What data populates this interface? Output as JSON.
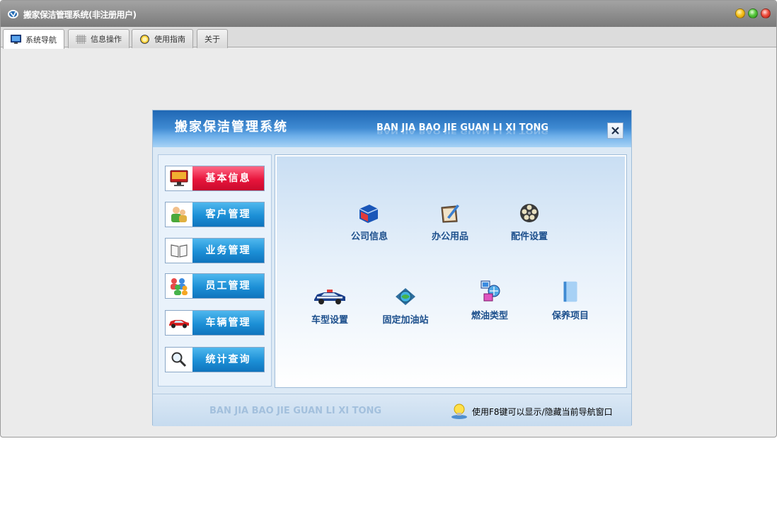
{
  "window": {
    "title": "搬家保洁管理系统(非注册用户)"
  },
  "tabs": [
    {
      "label": "系统导航",
      "icon": "monitor-icon",
      "active": true
    },
    {
      "label": "信息操作",
      "icon": "grid-icon",
      "active": false
    },
    {
      "label": "使用指南",
      "icon": "help-circle-icon",
      "active": false
    },
    {
      "label": "关于",
      "icon": "",
      "active": false
    }
  ],
  "nav_panel": {
    "title": "搬家保洁管理系统",
    "subtitle": "BAN JIA BAO JIE GUAN LI XI TONG",
    "menu": [
      {
        "label": "基本信息",
        "icon": "monitor-icon",
        "active": true
      },
      {
        "label": "客户管理",
        "icon": "people-icon",
        "active": false
      },
      {
        "label": "业务管理",
        "icon": "book-icon",
        "active": false
      },
      {
        "label": "员工管理",
        "icon": "team-icon",
        "active": false
      },
      {
        "label": "车辆管理",
        "icon": "car-icon",
        "active": false
      },
      {
        "label": "统计查询",
        "icon": "magnifier-icon",
        "active": false
      }
    ],
    "items": [
      {
        "label": "公司信息",
        "icon": "folder-icon"
      },
      {
        "label": "办公用品",
        "icon": "pen-folder-icon"
      },
      {
        "label": "配件设置",
        "icon": "film-reel-icon"
      },
      {
        "label": "车型设置",
        "icon": "police-car-icon"
      },
      {
        "label": "固定加油站",
        "icon": "globe-icon"
      },
      {
        "label": "燃油类型",
        "icon": "network-icon"
      },
      {
        "label": "保养项目",
        "icon": "book-stack-icon"
      }
    ],
    "footer_text": "BAN JIA BAO JIE GUAN LI XI TONG",
    "footer_hint": "使用F8键可以显示/隐藏当前导航窗口"
  },
  "colors": {
    "header_blue": "#1f67b4",
    "menu_blue": "#1c8fd6",
    "menu_active_red": "#e8153c",
    "item_label": "#1c4f8c"
  }
}
